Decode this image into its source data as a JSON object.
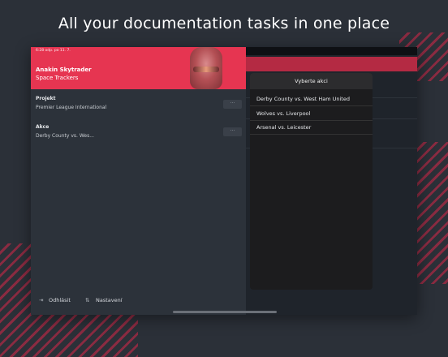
{
  "headline": "All your documentation tasks in one place",
  "status_bar": "6:28 odp.   po 11. 7.",
  "profile": {
    "name": "Anakin Skytrader",
    "team": "Space Trackers"
  },
  "fields": [
    {
      "label": "Projekt",
      "value": "Premier League International",
      "button": "···"
    },
    {
      "label": "Akce",
      "value": "Derby County vs. Wes...",
      "button": "···"
    }
  ],
  "bottom_bar": {
    "logout_label": "Odhlásit",
    "settings_label": "Nastavení"
  },
  "popover": {
    "title": "Vyberte akci",
    "items": [
      "Derby County vs. West Ham United",
      "Wolves vs. Liverpool",
      "Arsenal vs. Leicester"
    ]
  },
  "colors": {
    "accent": "#e63551",
    "background": "#2b3038"
  }
}
